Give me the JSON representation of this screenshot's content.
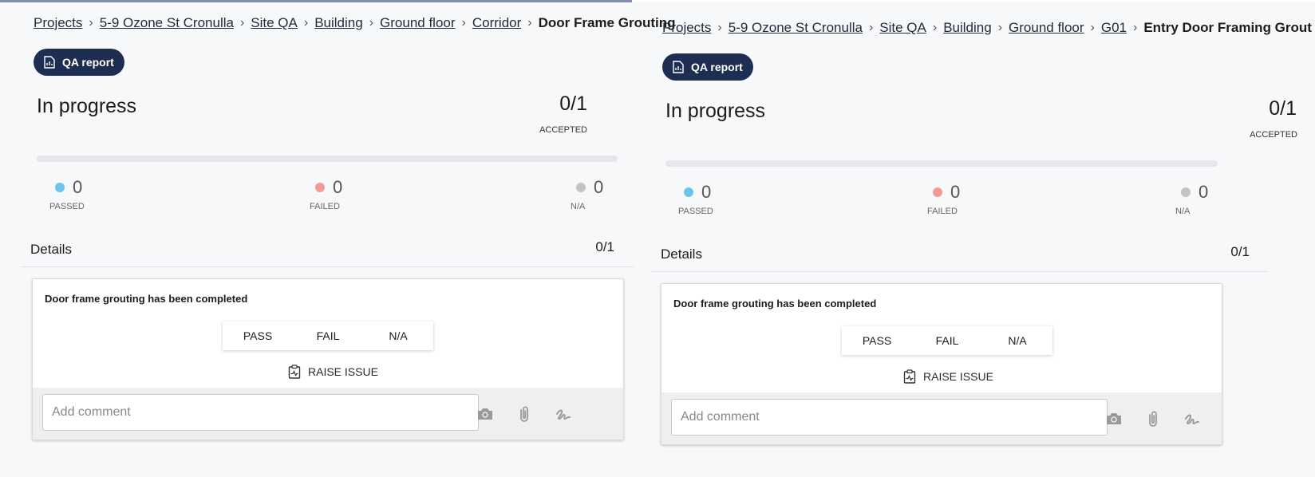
{
  "panels": [
    {
      "breadcrumb": {
        "links": [
          "Projects",
          "5-9 Ozone St Cronulla",
          "Site QA",
          "Building",
          "Ground floor",
          "Corridor"
        ],
        "current": "Door Frame Grouting"
      },
      "qa_report_label": "QA report",
      "status": "In progress",
      "accepted_count": "0/1",
      "accepted_label": "ACCEPTED",
      "progress_fraction": 0,
      "metrics": {
        "passed": {
          "value": "0",
          "label": "PASSED",
          "color": "#6cc4e8"
        },
        "failed": {
          "value": "0",
          "label": "FAILED",
          "color": "#f59898"
        },
        "na": {
          "value": "0",
          "label": "N/A",
          "color": "#c4c4c4"
        }
      },
      "details": {
        "title": "Details",
        "count": "0/1"
      },
      "item": {
        "question": "Door frame grouting has been completed",
        "choices": [
          "PASS",
          "FAIL",
          "N/A"
        ],
        "raise_issue": "RAISE ISSUE",
        "comment_placeholder": "Add comment"
      }
    },
    {
      "breadcrumb": {
        "links": [
          "Projects",
          "5-9 Ozone St Cronulla",
          "Site QA",
          "Building",
          "Ground floor",
          "G01"
        ],
        "current": "Entry Door Framing Grout"
      },
      "qa_report_label": "QA report",
      "status": "In progress",
      "accepted_count": "0/1",
      "accepted_label": "ACCEPTED",
      "progress_fraction": 0,
      "metrics": {
        "passed": {
          "value": "0",
          "label": "PASSED",
          "color": "#6cc4e8"
        },
        "failed": {
          "value": "0",
          "label": "FAILED",
          "color": "#f59898"
        },
        "na": {
          "value": "0",
          "label": "N/A",
          "color": "#c4c4c4"
        }
      },
      "details": {
        "title": "Details",
        "count": "0/1"
      },
      "item": {
        "question": "Door frame grouting has been completed",
        "choices": [
          "PASS",
          "FAIL",
          "N/A"
        ],
        "raise_issue": "RAISE ISSUE",
        "comment_placeholder": "Add comment"
      }
    }
  ],
  "icons": {
    "qa_report": "document-chart-icon",
    "raise_issue": "clipboard-issue-icon",
    "camera": "camera-icon",
    "attach": "paperclip-icon",
    "signature": "signature-icon"
  },
  "colors": {
    "accent": "#1d2e52",
    "toolbar_icon": "#9a9a9a"
  }
}
